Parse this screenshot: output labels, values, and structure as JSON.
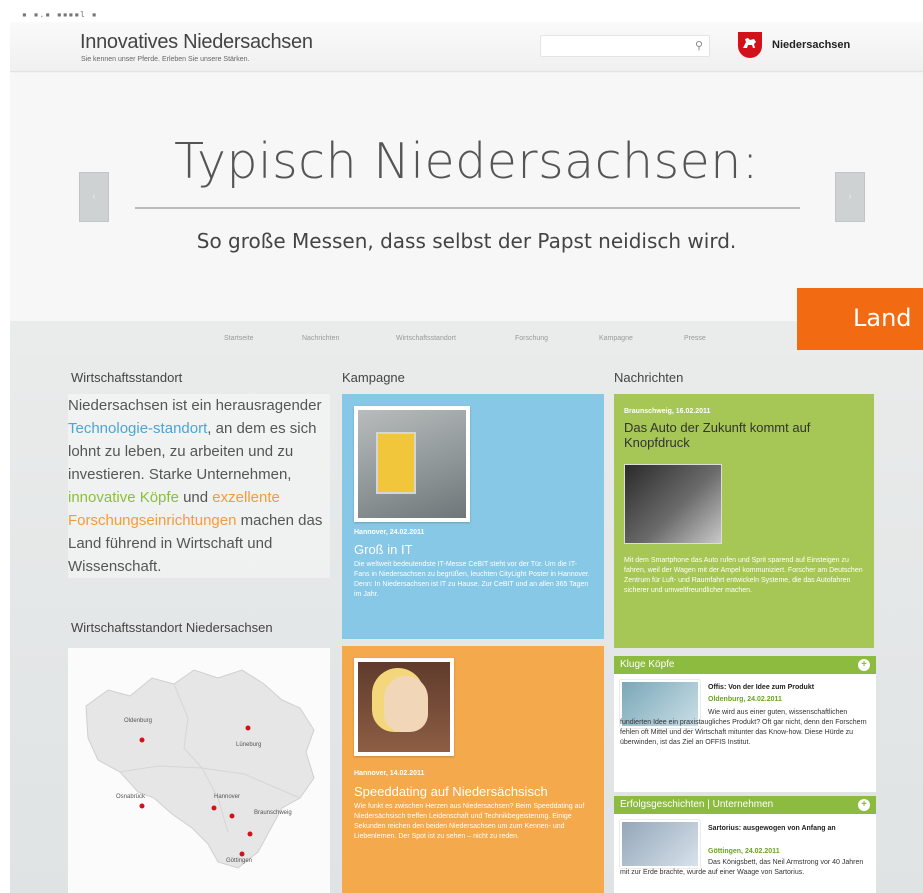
{
  "topbar": {
    "dots": "▪ ▪.▪  ▪▪▪▪l ▪"
  },
  "header": {
    "title": "Innovatives Niedersachsen",
    "tagline": "Sie kennen unser Pferde. Erleben Sie unsere Stärken.",
    "search_placeholder": "",
    "brand": "Niedersachsen"
  },
  "hero": {
    "title": "Typisch Niedersachsen:",
    "subtitle": "So große Messen, dass selbst der Papst neidisch wird.",
    "prev": "‹",
    "next": "›",
    "badge": "Land"
  },
  "nav": [
    "Startseite",
    "Nachrichten",
    "Wirtschaftsstandort",
    "Forschung",
    "Kampagne",
    "Presse"
  ],
  "left": {
    "title": "Wirtschaftsstandort",
    "intro_1": "Niedersachsen ist ein herausragender ",
    "intro_link_1": "Technologie-standort",
    "intro_2": ", an dem es sich lohnt zu leben, zu arbeiten und zu investieren. Starke Unternehmen, ",
    "intro_link_2": "innovative Köpfe",
    "intro_3": " und ",
    "intro_link_3": "exzellente Forschungseinrichtungen",
    "intro_4": " machen das Land führend in Wirtschaft und Wissenschaft.",
    "map_title": "Wirtschaftsstandort Niedersachsen",
    "cities": [
      "Oldenburg",
      "Lüneburg",
      "Osnabrück",
      "Hannover",
      "Braunschweig",
      "Göttingen"
    ]
  },
  "middle": {
    "title": "Kampagne",
    "card1": {
      "meta": "Hannover, 24.02.2011",
      "head": "Groß in IT",
      "body": "Die weltweit bedeutendste IT-Messe CeBIT steht vor der Tür. Um die IT-Fans in Niedersachsen zu begrüßen, leuchten CityLight Poster in Hannover. Denn: In Niedersachsen ist IT zu Hause. Zur CeBIT und an allen 365 Tagen im Jahr."
    },
    "card2": {
      "meta": "Hannover, 14.02.2011",
      "head": "Speeddating auf Niedersächsisch",
      "body": "Wie funkt es zwischen Herzen aus Niedersachsen? Beim Speeddating auf Niedersächsisch treffen Leidenschaft und Technikbegeisterung. Einige Sekunden reichen den beiden Niedersachsen um zum Kennen- und Liebenlernen. Der Spot ist zu sehen – nicht zu reden."
    }
  },
  "right": {
    "title": "Nachrichten",
    "news": {
      "meta": "Braunschweig, 16.02.2011",
      "head": "Das Auto der Zukunft kommt auf Knopfdruck",
      "body": "Mit dem Smartphone das Auto rufen und Sprit sparend auf Einsteigen zu fahren, weil der Wagen mit der Ampel kommuniziert. Forscher am Deutschen Zentrum für Luft- und Raumfahrt entwickeln Systeme, die das Autofahren sicherer und umweltfreundlicher machen."
    },
    "panel1": {
      "head": "Kluge Köpfe",
      "plus": "+",
      "title": "Offis: Von der Idee zum Produkt",
      "date": "Oldenburg, 24.02.2011",
      "text": "Wie wird aus einer guten, wissenschaftlichen fundierten Idee ein praxistaugliches Produkt? Oft gar nicht, denn den Forschern fehlen oft Mittel und der Wirtschaft mitunter das Know-how. Diese Hürde zu überwinden, ist das Ziel an OFFIS Institut."
    },
    "panel2": {
      "head": "Erfolgsgeschichten | Unternehmen",
      "plus": "+",
      "title": "Sartorius: ausgewogen von Anfang an",
      "date": "Göttingen, 24.02.2011",
      "text": "Das Königsbett, das Neil Armstrong vor 40 Jahren mit zur Erde brachte, wurde auf einer Waage von Sartorius."
    }
  }
}
